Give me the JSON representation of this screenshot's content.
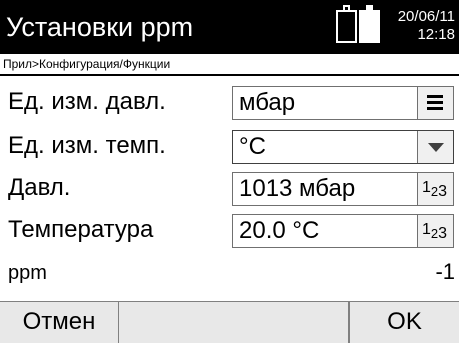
{
  "header": {
    "title": "Установки ppm",
    "date": "20/06/11",
    "time": "12:18",
    "battery_icons": [
      "battery-empty-icon",
      "battery-full-icon"
    ]
  },
  "breadcrumb": "Прил>Конфигурация/Функции",
  "rows": {
    "pressure_unit": {
      "label": "Ед. изм. давл.",
      "value": "мбар",
      "icon": "list-icon"
    },
    "temperature_unit": {
      "label": "Ед. изм. темп.",
      "value": "°C",
      "icon": "dropdown-arrow-icon"
    },
    "pressure": {
      "label": "Давл.",
      "value": "1013 мбар",
      "icon": "numeric-input-icon",
      "icon_text": "1",
      "icon_sub": "2",
      "icon_sub2": "3"
    },
    "temperature": {
      "label": "Температура",
      "value": "20.0 °C",
      "icon": "numeric-input-icon",
      "icon_text": "1",
      "icon_sub": "2",
      "icon_sub2": "3"
    },
    "ppm": {
      "label": "ppm",
      "value": "-1"
    }
  },
  "softkeys": {
    "left": "Отмен",
    "middle": "",
    "right": "OK"
  },
  "colors": {
    "titlebar_bg": "#000000",
    "titlebar_fg": "#ffffff",
    "softkey_bg": "#e8e8e8"
  }
}
